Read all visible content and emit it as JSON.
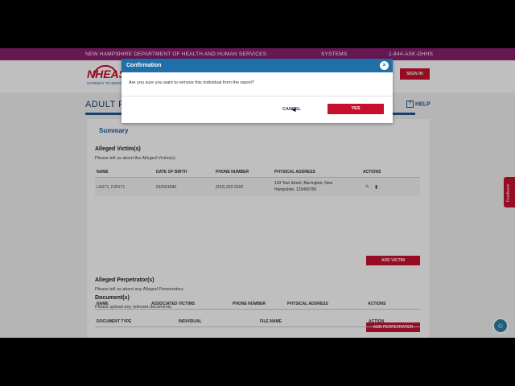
{
  "topbar": {
    "agency": "NEW HAMPSHIRE DEPARTMENT OF HEALTH AND HUMAN SERVICES",
    "systems": "SYSTEMS",
    "phone": "1-844-ASK-DHHS"
  },
  "header": {
    "logo_text": "NHEASY",
    "logo_sub": "GATEWAY TO SERVICES",
    "signin": "SIGN IN"
  },
  "page": {
    "title": "ADULT P",
    "help": "HELP",
    "help_icon": "?"
  },
  "summary": "Summary",
  "victims": {
    "title": "Alleged Victim(s)",
    "subtitle": "Please tell us about the Alleged Victim(s).",
    "columns": [
      "NAME",
      "DATE OF BIRTH",
      "PHONE NUMBER",
      "PHYSICAL ADDRESS",
      "ACTIONS"
    ],
    "rows": [
      {
        "name": "LAST1, FIRST1",
        "dob": "01/01/1990",
        "phone": "(222) 222-2222",
        "address1": "123 Test Street, Barrington, New",
        "address2": "Hampshire, 123456789"
      }
    ],
    "add_button": "ADD VICTIM"
  },
  "perpetrators": {
    "title": "Alleged Perpetrator(s)",
    "subtitle": "Please tell us about any Alleged Perpetrators.",
    "columns": [
      "NAME",
      "ASSOCIATED VICTIMS",
      "PHONE NUMBER",
      "PHYSICAL ADDRESS",
      "ACTIONS"
    ],
    "add_button": "ADD PERPETRATOR"
  },
  "documents": {
    "title": "Document(s)",
    "subtitle": "Please upload any relevant documents.",
    "columns": [
      "DOCUMENT TYPE",
      "INDIVIDUAL",
      "FILE NAME",
      "ACTION"
    ]
  },
  "modal": {
    "title": "Confirmation",
    "close": "×",
    "message": "Are you sure you want to remove this individual from the report?",
    "cancel": "CANCEL",
    "yes": "YES"
  },
  "feedback": "Feedback",
  "icons": {
    "edit": "edit-icon",
    "delete": "trash-icon",
    "chat": "chat-icon"
  },
  "colors": {
    "brand_purple": "#8a1f6e",
    "accent_red": "#c8102e",
    "primary_blue": "#1f6fa8"
  }
}
